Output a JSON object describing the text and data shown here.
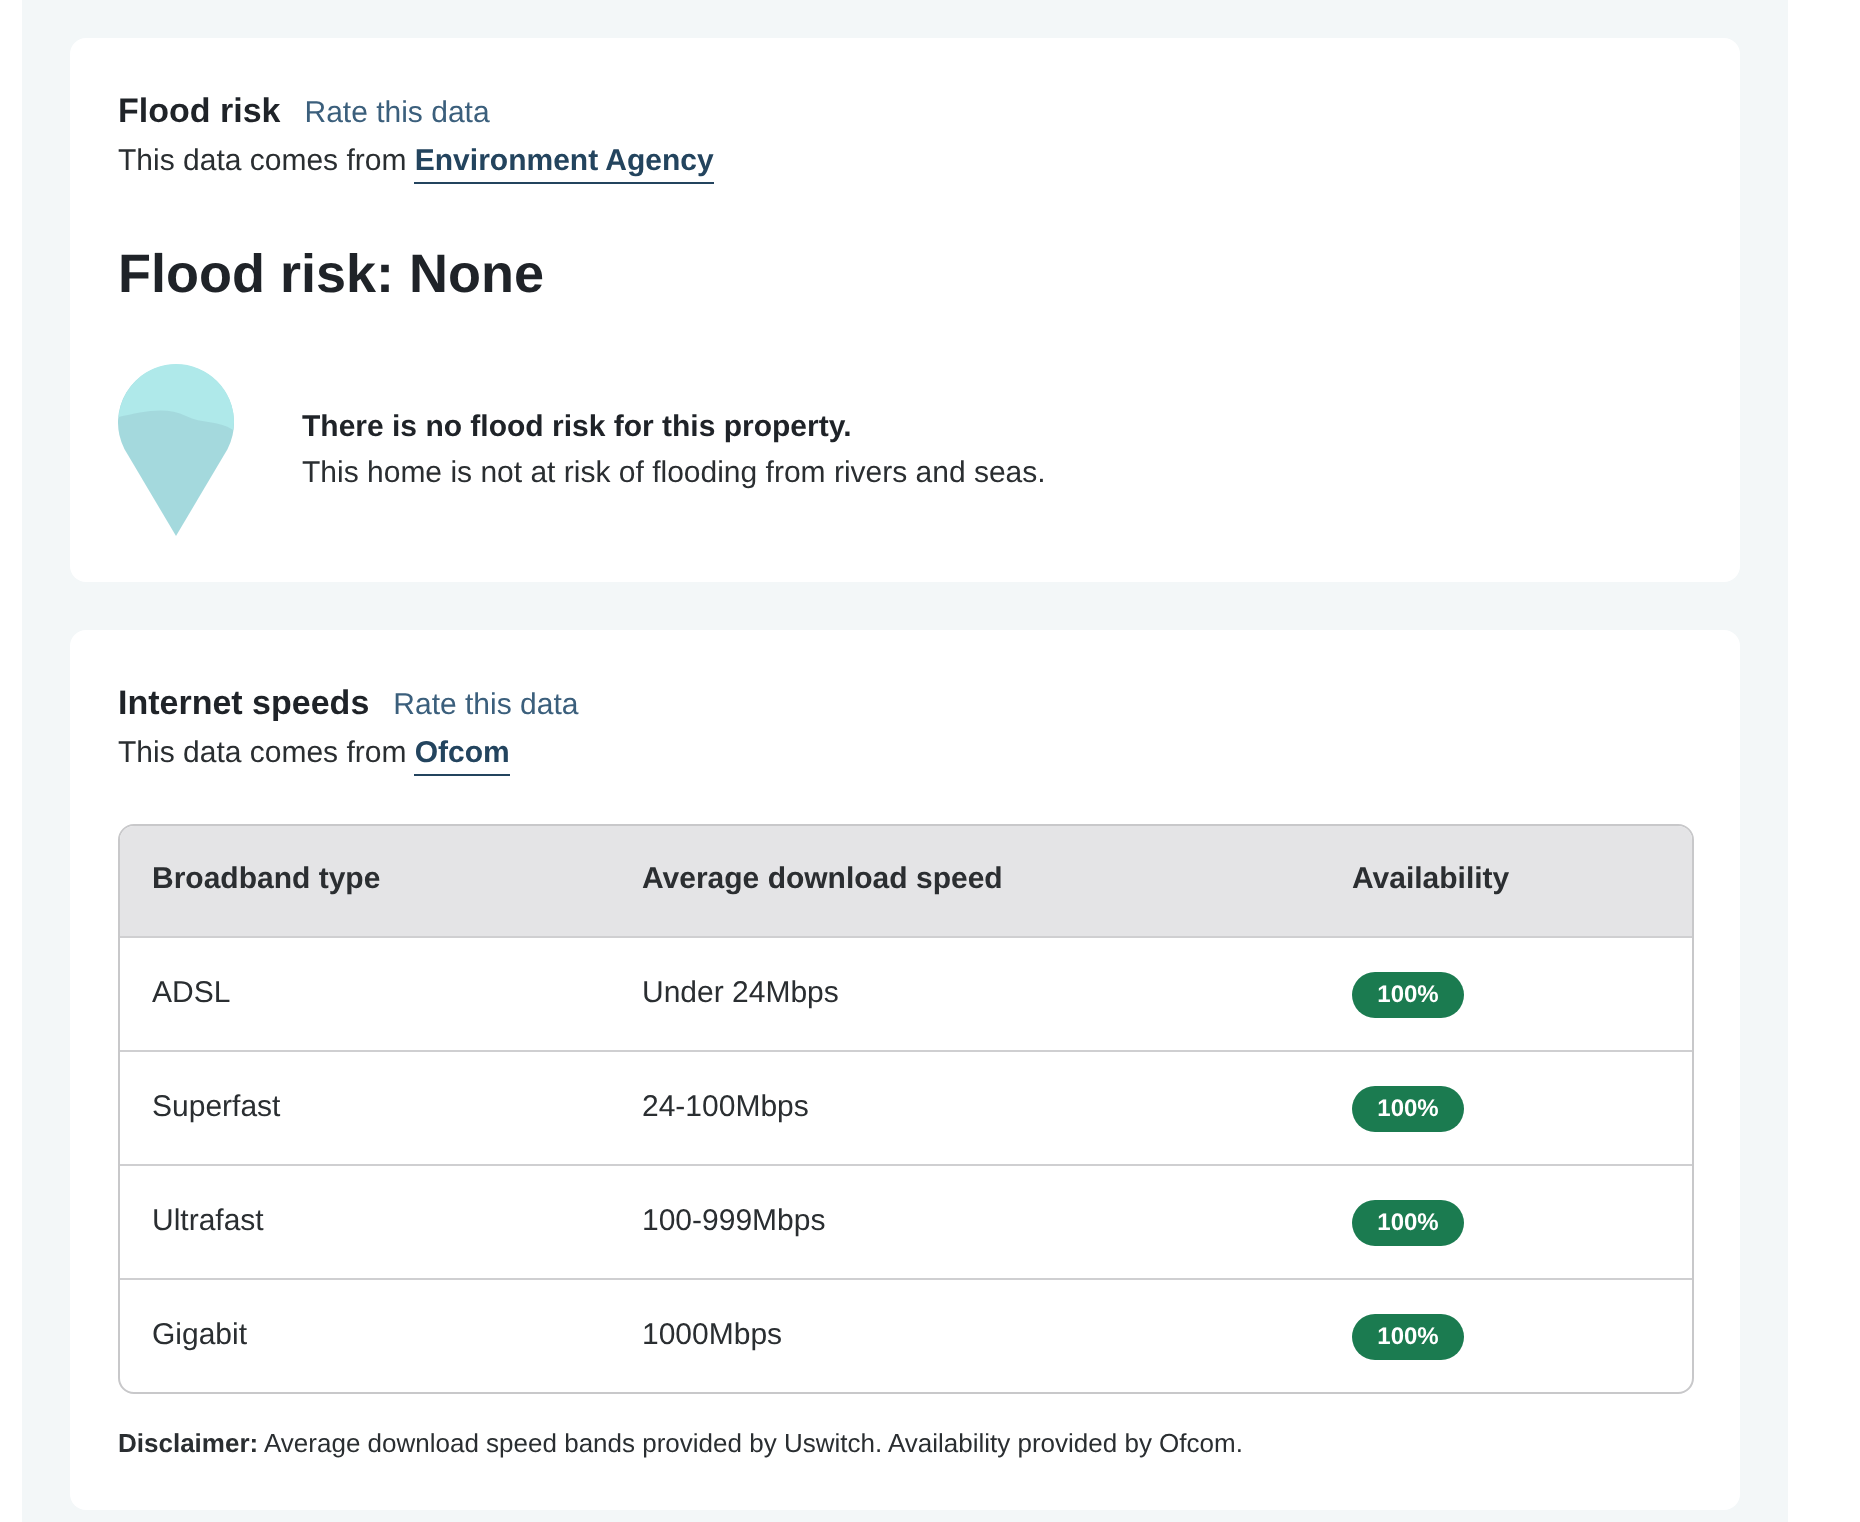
{
  "flood_risk": {
    "title": "Flood risk",
    "rate_link": "Rate this data",
    "source_prefix": "This data comes from",
    "source_link": "Environment Agency",
    "heading": "Flood risk: None",
    "message_title": "There is no flood risk for this property.",
    "message_body": "This home is not at risk of flooding from rivers and seas."
  },
  "internet_speeds": {
    "title": "Internet speeds",
    "rate_link": "Rate this data",
    "source_prefix": "This data comes from",
    "source_link": "Ofcom",
    "table": {
      "columns": [
        "Broadband type",
        "Average download speed",
        "Availability"
      ],
      "rows": [
        {
          "broadband_type": "ADSL",
          "average_download_speed": "Under 24Mbps",
          "availability": "100%"
        },
        {
          "broadband_type": "Superfast",
          "average_download_speed": "24-100Mbps",
          "availability": "100%"
        },
        {
          "broadband_type": "Ultrafast",
          "average_download_speed": "100-999Mbps",
          "availability": "100%"
        },
        {
          "broadband_type": "Gigabit",
          "average_download_speed": "1000Mbps",
          "availability": "100%"
        }
      ]
    },
    "disclaimer": "**Disclaimer:** Average download speed bands provided by Uswitch. Availability provided by Ofcom."
  }
}
